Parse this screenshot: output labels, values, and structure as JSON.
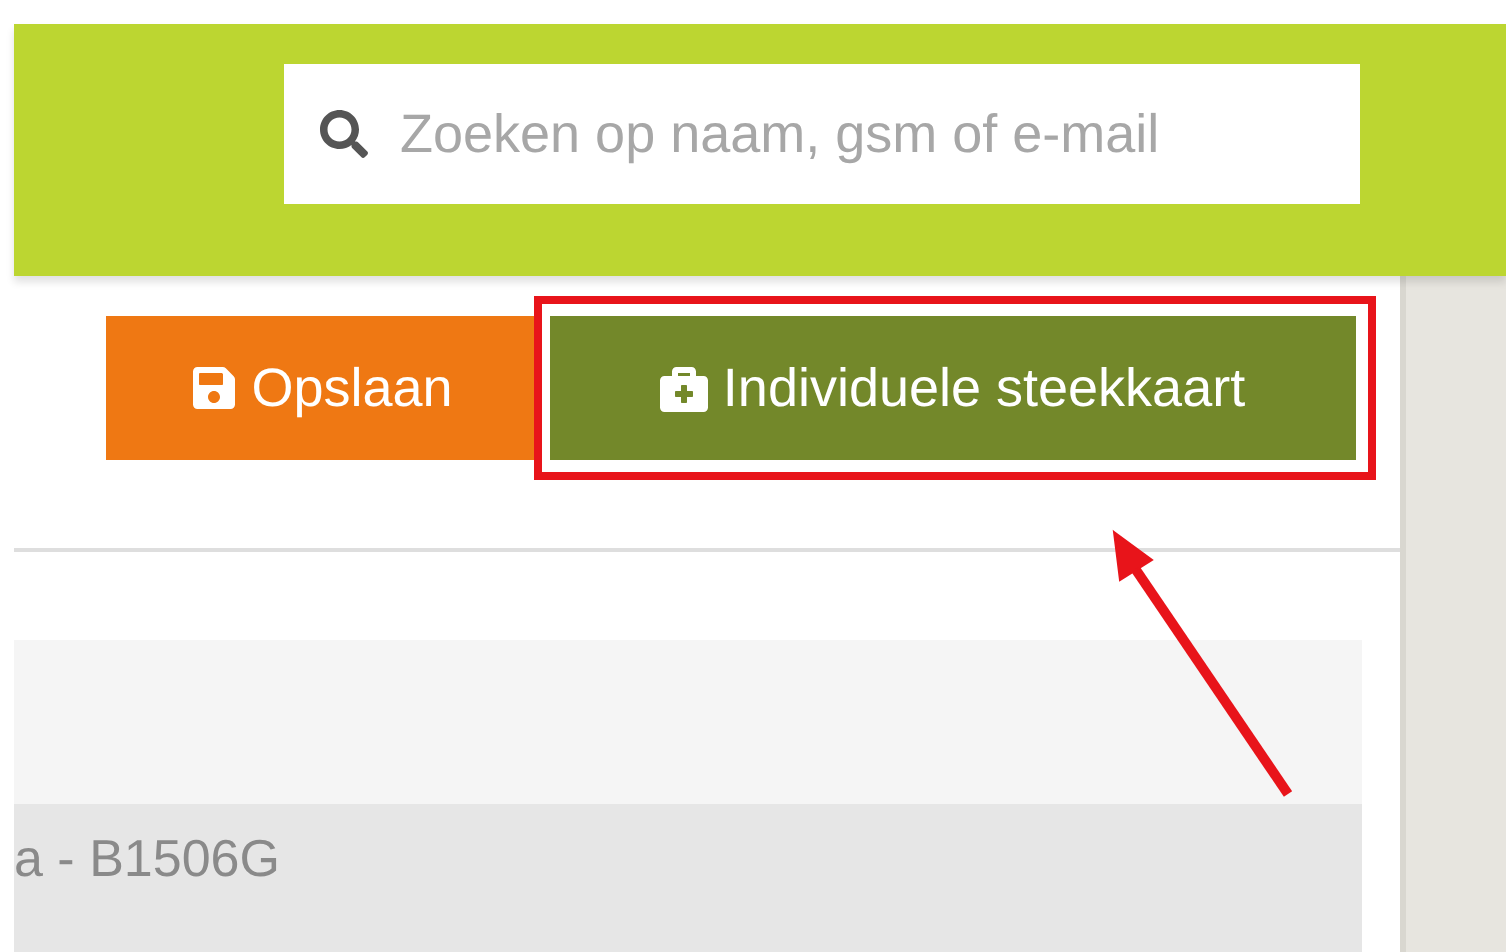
{
  "search": {
    "placeholder": "Zoeken op naam, gsm of e-mail"
  },
  "buttons": [
    {
      "kind": "save",
      "label": "Opslaan",
      "highlighted": false
    },
    {
      "kind": "medical",
      "label": "Individuele steekkaart",
      "highlighted": true
    }
  ],
  "record": {
    "title": "a - B1506G"
  }
}
